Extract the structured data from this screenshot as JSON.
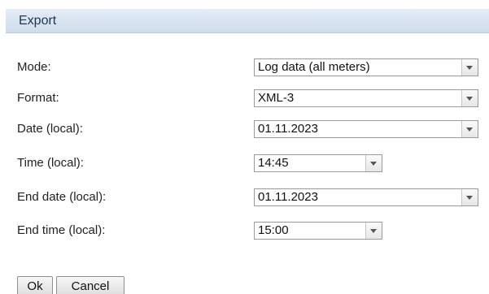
{
  "dialog": {
    "title": "Export"
  },
  "fields": {
    "mode": {
      "label": "Mode:",
      "value": "Log data (all meters)"
    },
    "format": {
      "label": "Format:",
      "value": "XML-3"
    },
    "date": {
      "label": "Date (local):",
      "value": "01.11.2023"
    },
    "time": {
      "label": "Time (local):",
      "value": "14:45"
    },
    "end_date": {
      "label": "End date (local):",
      "value": "01.11.2023"
    },
    "end_time": {
      "label": "End time (local):",
      "value": "15:00"
    }
  },
  "buttons": {
    "ok_label": "Ok",
    "cancel_label": "Cancel"
  },
  "icons": {
    "dropdown": "chevron-down-icon"
  },
  "colors": {
    "title_bar": "#d6e2f0",
    "title_text": "#1f3550"
  }
}
